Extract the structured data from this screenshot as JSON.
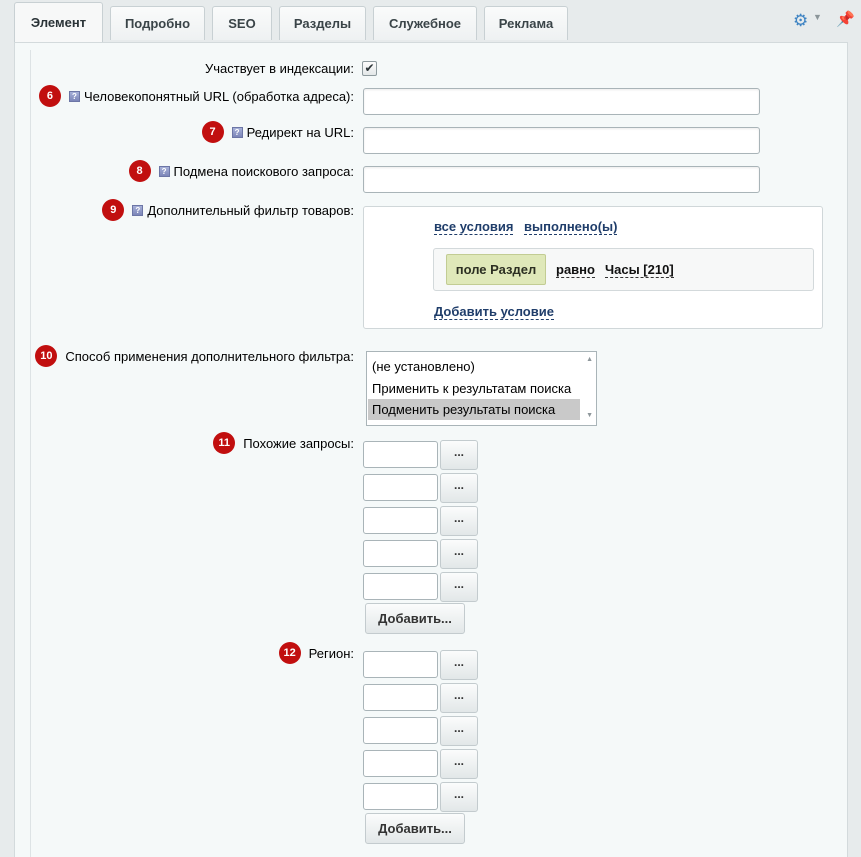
{
  "tabs": [
    {
      "label": "Элемент",
      "active": true
    },
    {
      "label": "Подробно"
    },
    {
      "label": "SEO"
    },
    {
      "label": "Разделы"
    },
    {
      "label": "Служебное"
    },
    {
      "label": "Реклама"
    }
  ],
  "toolbar": {
    "settings_icon": "gear-icon",
    "pin_icon": "pin-icon"
  },
  "form": {
    "indexing_label": "Участвует в индексации:",
    "indexing_checked": true,
    "human_url_label": "Человекопонятный URL (обработка адреса):",
    "redirect_label": "Редирект на URL:",
    "query_replace_label": "Подмена поискового запроса:",
    "extra_filter_label": "Дополнительный фильтр товаров:",
    "filter_mode_label": "Способ применения дополнительного фильтра:",
    "similar_label": "Похожие запросы:",
    "region_label": "Регион:"
  },
  "badges": {
    "b6": "6",
    "b7": "7",
    "b8": "8",
    "b9": "9",
    "b10": "10",
    "b11": "11",
    "b12": "12"
  },
  "help_icon_text": "?",
  "filter": {
    "all_conditions": "все условия",
    "fulfilled": "выполнено(ы)",
    "field": "поле Раздел",
    "operator": "равно",
    "value": "Часы [210]",
    "add_condition": "Добавить условие"
  },
  "filter_mode_options": [
    {
      "label": "(не установлено)"
    },
    {
      "label": "Применить к результатам поиска"
    },
    {
      "label": "Подменить результаты поиска",
      "selected": true
    }
  ],
  "picker_button_label": "...",
  "add_button_label": "Добавить...",
  "colors": {
    "badge": "#c10f0f",
    "link": "#1f3d6a",
    "chip": "#dfe8b9",
    "accent": "#3f84c3"
  }
}
